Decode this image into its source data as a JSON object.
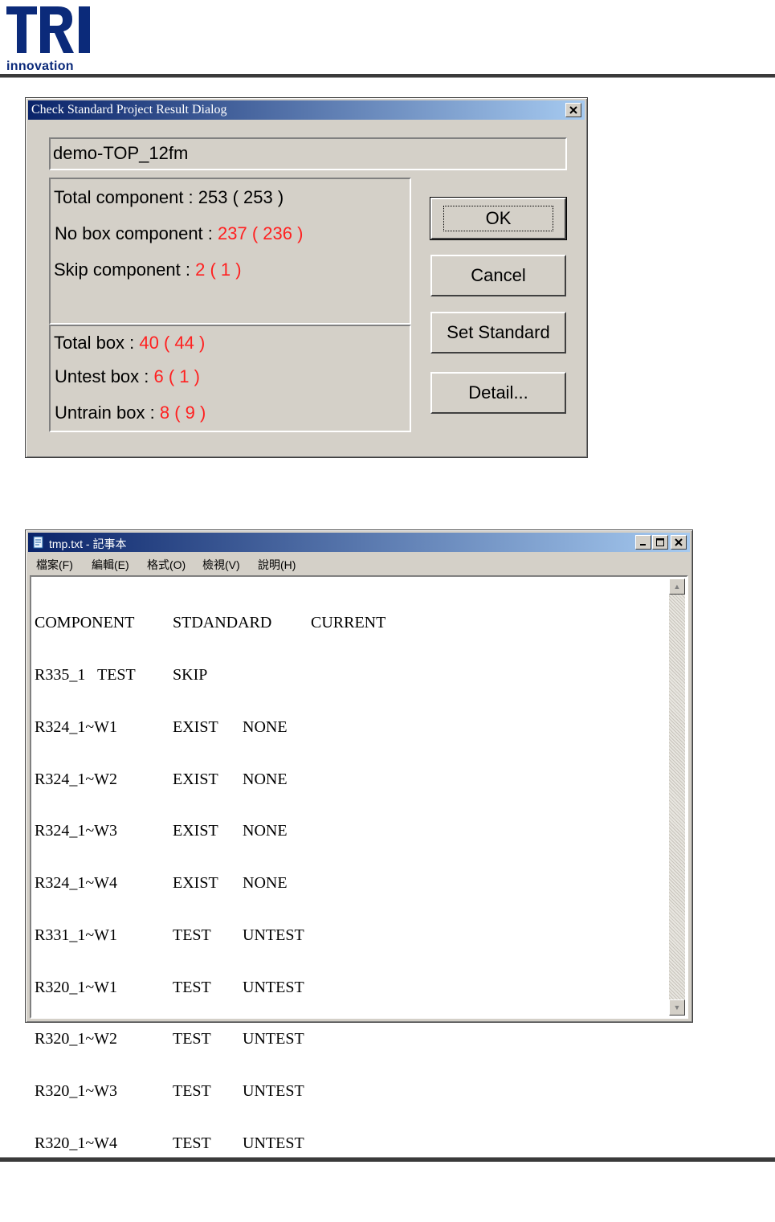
{
  "logo": {
    "letters": "TRI",
    "text": "innovation"
  },
  "dialog": {
    "title": "Check Standard Project Result Dialog",
    "close_icon": "close-icon",
    "project_name": "demo-TOP_12fm",
    "components": [
      {
        "label": "Total component :",
        "value": "253 ( 253 )",
        "color": "#000000"
      },
      {
        "label": "No box component :",
        "value": "237 ( 236 )",
        "color": "#ff2020"
      },
      {
        "label": "Skip component :",
        "value": "2 ( 1 )",
        "color": "#ff2020"
      }
    ],
    "boxes": [
      {
        "label": "Total box :",
        "value": "40 ( 44 )",
        "color": "#ff2020"
      },
      {
        "label": "Untest box :",
        "value": "6 ( 1 )",
        "color": "#ff2020"
      },
      {
        "label": "Untrain box :",
        "value": "8 ( 9 )",
        "color": "#ff2020"
      }
    ],
    "buttons": {
      "ok": "OK",
      "cancel": "Cancel",
      "set_standard": "Set Standard",
      "detail": "Detail..."
    }
  },
  "notepad": {
    "title": "tmp.txt - 記事本",
    "menu": [
      "檔案(F)",
      "編輯(E)",
      "格式(O)",
      "檢視(V)",
      "說明(H)"
    ],
    "header": {
      "component": "COMPONENT",
      "standard": "STDANDARD",
      "current": "CURRENT"
    },
    "rows": [
      {
        "component": "R335_1   TEST",
        "standard": "SKIP",
        "current": ""
      },
      {
        "component": "R324_1~W1",
        "standard": "EXIST",
        "current": "NONE"
      },
      {
        "component": "R324_1~W2",
        "standard": "EXIST",
        "current": "NONE"
      },
      {
        "component": "R324_1~W3",
        "standard": "EXIST",
        "current": "NONE"
      },
      {
        "component": "R324_1~W4",
        "standard": "EXIST",
        "current": "NONE"
      },
      {
        "component": "R331_1~W1",
        "standard": "TEST",
        "current": "UNTEST"
      },
      {
        "component": "R320_1~W1",
        "standard": "TEST",
        "current": "UNTEST"
      },
      {
        "component": "R320_1~W2",
        "standard": "TEST",
        "current": "UNTEST"
      },
      {
        "component": "R320_1~W3",
        "standard": "TEST",
        "current": "UNTEST"
      },
      {
        "component": "R320_1~W4",
        "standard": "TEST",
        "current": "UNTEST"
      }
    ]
  }
}
